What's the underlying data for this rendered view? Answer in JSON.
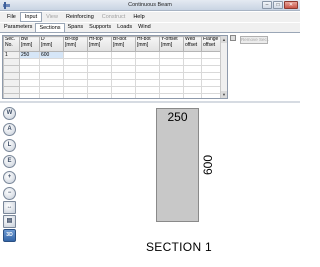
{
  "window": {
    "title": "Continuous Beam",
    "minimize": "–",
    "maximize": "□",
    "close": "✕"
  },
  "menu": [
    {
      "label": "File",
      "enabled": true
    },
    {
      "label": "Input",
      "enabled": true
    },
    {
      "label": "View",
      "enabled": false
    },
    {
      "label": "Reinforcing",
      "enabled": true
    },
    {
      "label": "Construct",
      "enabled": false
    },
    {
      "label": "Help",
      "enabled": true
    }
  ],
  "tabs": [
    "Parameters",
    "Sections",
    "Spans",
    "Supports",
    "Loads",
    "Wind"
  ],
  "active_tab": "Sections",
  "grid": {
    "headers": [
      [
        "Sec.",
        "No."
      ],
      [
        "Bw",
        "[mm]"
      ],
      [
        "D",
        "[mm]"
      ],
      [
        "Bf-top",
        "[mm]"
      ],
      [
        "Hf-top",
        "[mm]"
      ],
      [
        "Bf-bot",
        "[mm]"
      ],
      [
        "Hf-bot",
        "[mm]"
      ],
      [
        "Y-offset",
        "[mm]"
      ],
      [
        "Web",
        "offset"
      ],
      [
        "Flange",
        "offset"
      ]
    ],
    "rows": [
      [
        "1",
        "250",
        "600",
        "",
        "",
        "",
        "",
        "",
        "",
        ""
      ]
    ],
    "empty_rows": 10
  },
  "remove_button": "Remove Sect.",
  "toolbar": [
    {
      "icon": "w-zoom-icon",
      "glyph": "W"
    },
    {
      "icon": "a-zoom-icon",
      "glyph": "A"
    },
    {
      "icon": "l-zoom-icon",
      "glyph": "L"
    },
    {
      "icon": "e-zoom-icon",
      "glyph": "E"
    },
    {
      "icon": "zoom-in-icon",
      "glyph": "+"
    },
    {
      "icon": "zoom-out-icon",
      "glyph": "−"
    },
    {
      "icon": "pan-icon",
      "glyph": "↔"
    },
    {
      "icon": "print-icon",
      "glyph": "▤"
    },
    {
      "icon": "three-d-icon",
      "glyph": "3D"
    }
  ],
  "section": {
    "width_label": "250",
    "depth_label": "600",
    "title": "SECTION 1",
    "fill_color": "#c8c8c8"
  }
}
